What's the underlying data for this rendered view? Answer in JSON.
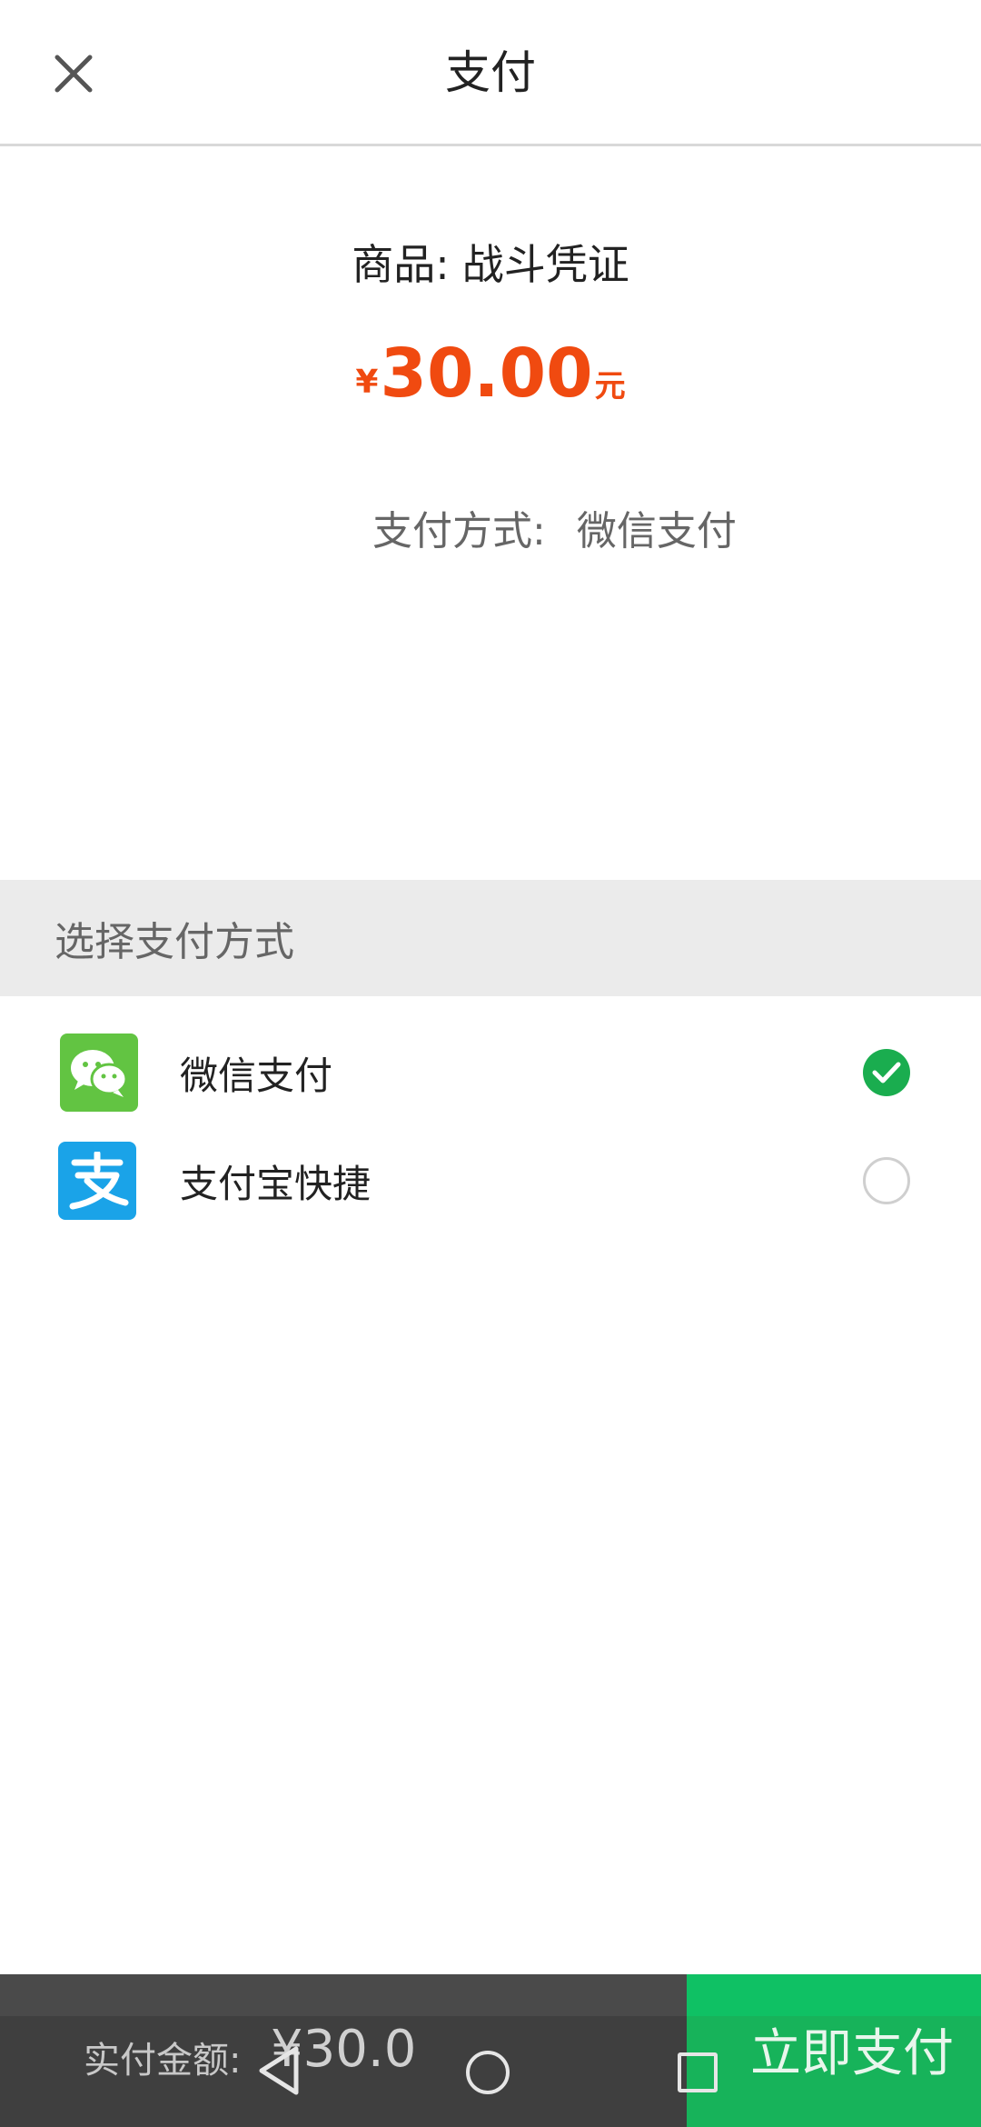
{
  "header": {
    "title": "支付",
    "close_icon": "close-icon"
  },
  "order": {
    "product_label": "商品:",
    "product_name": "战斗凭证",
    "currency_symbol": "¥",
    "amount": "30.00",
    "unit": "元",
    "method_label": "支付方式:",
    "method_value": "微信支付"
  },
  "payment_section": {
    "header": "选择支付方式",
    "options": [
      {
        "label": "微信支付",
        "icon": "wechat-icon",
        "selected": true
      },
      {
        "label": "支付宝快捷",
        "icon": "alipay-icon",
        "selected": false
      }
    ]
  },
  "footer": {
    "total_label": "实付金额:",
    "total_value": "¥30.0",
    "pay_button": "立即支付"
  },
  "colors": {
    "accent_red": "#f04a10",
    "accent_green": "#17b35a",
    "wechat_green": "#62c442",
    "alipay_blue": "#1aa3e8"
  },
  "nav": {
    "back_icon": "back-icon",
    "home_icon": "home-icon",
    "recent_icon": "recent-apps-icon"
  }
}
